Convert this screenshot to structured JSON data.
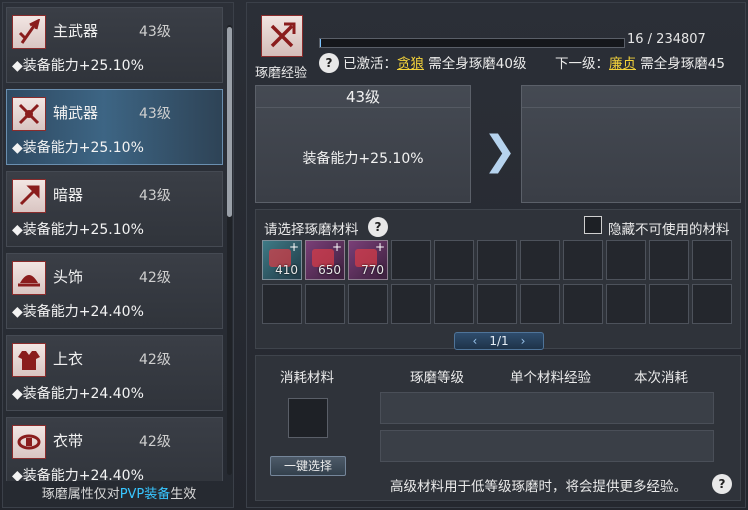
{
  "equipment": [
    {
      "name": "主武器",
      "level": "43级",
      "stat": "◆装备能力+25.10%",
      "icon": "spear-icon"
    },
    {
      "name": "辅武器",
      "level": "43级",
      "stat": "◆装备能力+25.10%",
      "icon": "crossed-weapons-icon"
    },
    {
      "name": "暗器",
      "level": "43级",
      "stat": "◆装备能力+25.10%",
      "icon": "dart-icon"
    },
    {
      "name": "头饰",
      "level": "42级",
      "stat": "◆装备能力+24.40%",
      "icon": "headgear-icon"
    },
    {
      "name": "上衣",
      "level": "42级",
      "stat": "◆装备能力+24.40%",
      "icon": "armor-icon"
    },
    {
      "name": "衣带",
      "level": "42级",
      "stat": "◆装备能力+24.40%",
      "icon": "belt-icon"
    }
  ],
  "footer": {
    "prefix": "琢磨属性仅对",
    "highlight": "PVP装备",
    "suffix": "生效"
  },
  "polish": {
    "label": "琢磨经验",
    "progress_text": "16 / 234807",
    "progress_fraction": 0.0001,
    "activated_prefix": "已激活：",
    "activated_link": "贪狼",
    "activated_suffix": " 需全身琢磨40级",
    "next_prefix": "下一级：",
    "next_link": "廉贞",
    "next_suffix": " 需全身琢磨45"
  },
  "current": {
    "level": "43级",
    "stat": "装备能力+25.10%"
  },
  "materials": {
    "title": "请选择琢磨材料",
    "hide_label": "隐藏不可使用的材料",
    "items": [
      {
        "count": "410",
        "plus": "+"
      },
      {
        "count": "650",
        "plus": "+"
      },
      {
        "count": "770",
        "plus": "+"
      }
    ],
    "page": "1/1"
  },
  "consume": {
    "col_material": "消耗材料",
    "col_level": "琢磨等级",
    "col_exp": "单个材料经验",
    "col_cost": "本次消耗",
    "onekey_button": "一键选择",
    "hint": "高级材料用于低等级琢磨时，将会提供更多经验。"
  },
  "help_glyph": "?",
  "colors": {
    "accent_blue": "#38c6ff",
    "link_yellow": "#f3d23a",
    "selected_row": "#3d6584"
  }
}
